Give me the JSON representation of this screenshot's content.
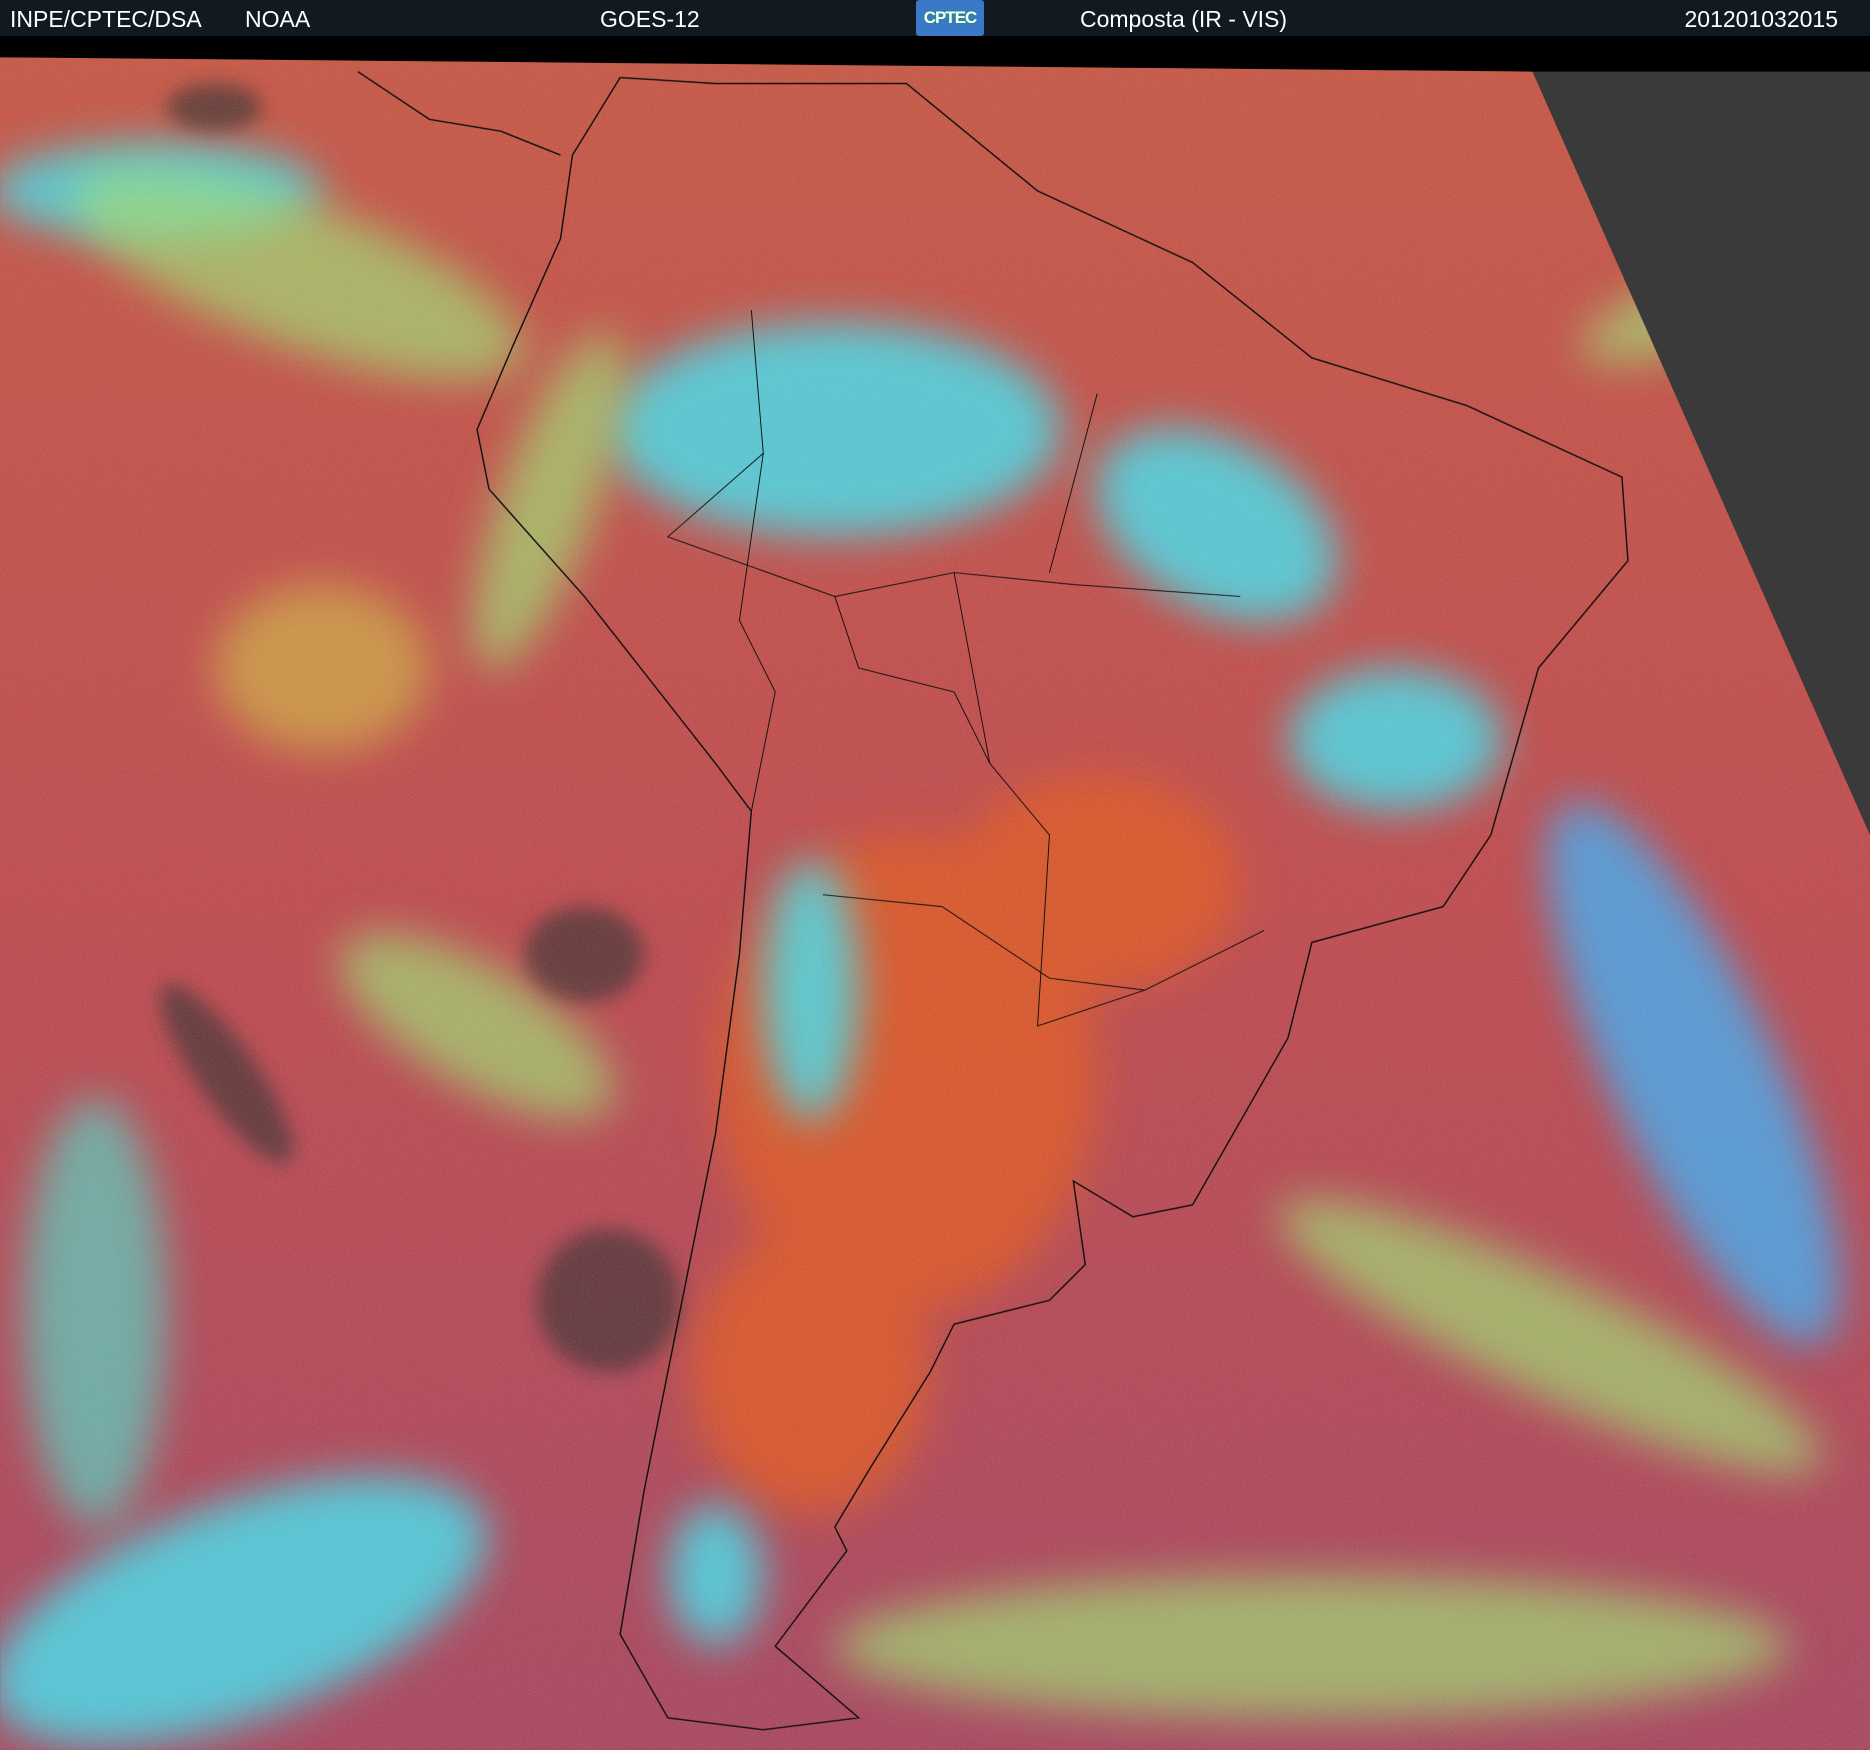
{
  "header": {
    "institution": "INPE/CPTEC/DSA",
    "agency": "NOAA",
    "satellite": "GOES-12",
    "logo_text": "CPTEC",
    "product": "Composta (IR - VIS)",
    "timestamp": "201201032015"
  },
  "colors": {
    "header_bg": "#111a21",
    "surface_red": "#c0463e",
    "land_orange": "#e0501e",
    "cloud_cyan": "#3ee8f0",
    "cloud_green": "#9ee070"
  }
}
